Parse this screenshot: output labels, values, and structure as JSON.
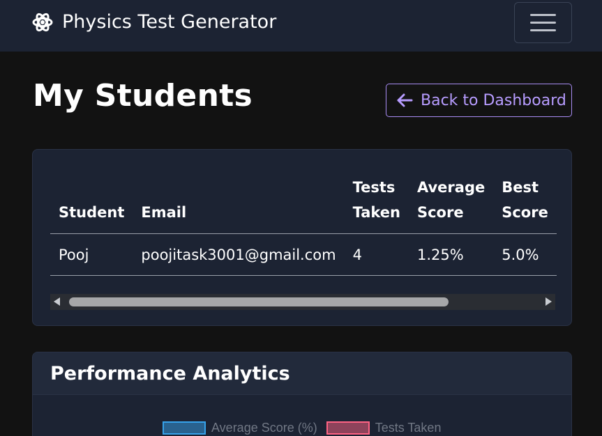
{
  "navbar": {
    "brand_icon": "atom-icon",
    "brand_title": "Physics Test Generator",
    "menu_icon": "hamburger-menu-icon"
  },
  "header": {
    "title": "My Students",
    "back_button_icon": "arrow-left-icon",
    "back_button_label": "Back to Dashboard"
  },
  "students_table": {
    "columns": [
      "Student",
      "Email",
      "Tests Taken",
      "Average Score",
      "Best Score"
    ],
    "column_lines": [
      [
        "Student"
      ],
      [
        "Email"
      ],
      [
        "Tests",
        "Taken"
      ],
      [
        "Average",
        "Score"
      ],
      [
        "Best",
        "Score"
      ]
    ],
    "rows": [
      [
        "Pooj",
        "poojitask3001@gmail.com",
        "4",
        "1.25%",
        "5.0%"
      ]
    ]
  },
  "analytics": {
    "title": "Performance Analytics",
    "legend": [
      {
        "label": "Average Score (%)",
        "color": "#36a2eb"
      },
      {
        "label": "Tests Taken",
        "color": "#ff6384"
      }
    ]
  },
  "colors": {
    "navbar_bg": "#1c2333",
    "page_bg": "#121212",
    "accent": "#b79cff"
  }
}
